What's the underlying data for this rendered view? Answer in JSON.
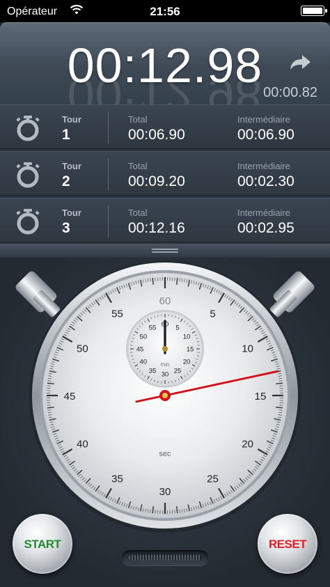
{
  "status_bar": {
    "carrier": "Opérateur",
    "time": "21:56"
  },
  "display": {
    "main_time": "00:12.98",
    "lap_time": "00:00.82"
  },
  "laps": [
    {
      "tour_label": "Tour",
      "number": "1",
      "total_label": "Total",
      "total": "00:06.90",
      "split_label": "Intermédiaire",
      "split": "00:06.90"
    },
    {
      "tour_label": "Tour",
      "number": "2",
      "total_label": "Total",
      "total": "00:09.20",
      "split_label": "Intermédiaire",
      "split": "00:02.30"
    },
    {
      "tour_label": "Tour",
      "number": "3",
      "total_label": "Total",
      "total": "00:12.16",
      "split_label": "Intermédiaire",
      "split": "00:02.95"
    }
  ],
  "dial": {
    "main_labels": [
      "60",
      "5",
      "10",
      "15",
      "20",
      "25",
      "30",
      "35",
      "40",
      "45",
      "50",
      "55"
    ],
    "main_unit": "sec",
    "sub_labels": [
      "60",
      "5",
      "10",
      "15",
      "20",
      "25",
      "30",
      "35",
      "40",
      "45",
      "50",
      "55"
    ],
    "sub_unit": "min",
    "seconds_value": 12.98,
    "minutes_value": 0,
    "colors": {
      "second_hand": "#d0141c",
      "minute_hand": "#222222"
    }
  },
  "buttons": {
    "start": "START",
    "reset": "RESET"
  },
  "icons": [
    "wifi-icon",
    "battery-icon",
    "share-arrow-icon",
    "stopwatch-icon",
    "drawer-grip-icon",
    "speaker-grille-icon"
  ]
}
